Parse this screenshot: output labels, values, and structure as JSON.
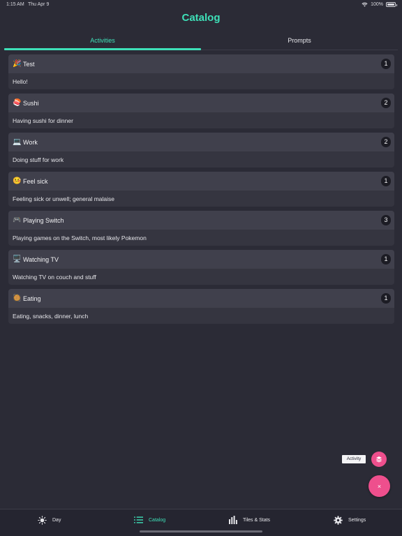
{
  "status": {
    "time": "1:15 AM",
    "date": "Thu Apr 9",
    "battery": "100%"
  },
  "header": {
    "title": "Catalog"
  },
  "tabs": [
    {
      "label": "Activities",
      "active": true
    },
    {
      "label": "Prompts",
      "active": false
    }
  ],
  "activities": [
    {
      "emoji": "🎉",
      "name": "Test",
      "count": "1",
      "description": "Hello!"
    },
    {
      "emoji": "🍣",
      "name": "Sushi",
      "count": "2",
      "description": "Having sushi for dinner"
    },
    {
      "emoji": "💻",
      "name": "Work",
      "count": "2",
      "description": "Doing stuff for work"
    },
    {
      "emoji": "🤒",
      "name": "Feel sick",
      "count": "1",
      "description": "Feeling sick or unwell; general malaise"
    },
    {
      "emoji": "🎮",
      "name": "Playing Switch",
      "count": "3",
      "description": "Playing games on the Switch, most likely Pokemon"
    },
    {
      "emoji": "🖥️",
      "name": "Watching TV",
      "count": "1",
      "description": "Watching TV on couch and stuff"
    },
    {
      "emoji": "🥘",
      "name": "Eating",
      "count": "1",
      "description": "Eating, snacks, dinner, lunch"
    }
  ],
  "fab": {
    "tooltip": "Activity",
    "close_glyph": "×"
  },
  "bottom_nav": [
    {
      "label": "Day",
      "icon": "sun-icon",
      "active": false
    },
    {
      "label": "Catalog",
      "icon": "list-icon",
      "active": true
    },
    {
      "label": "Tiles & Stats",
      "icon": "bar-chart-icon",
      "active": false
    },
    {
      "label": "Settings",
      "icon": "gear-icon",
      "active": false
    }
  ],
  "colors": {
    "accent": "#3ee0b8",
    "fab": "#ee4f8d",
    "background": "#2b2b36"
  }
}
